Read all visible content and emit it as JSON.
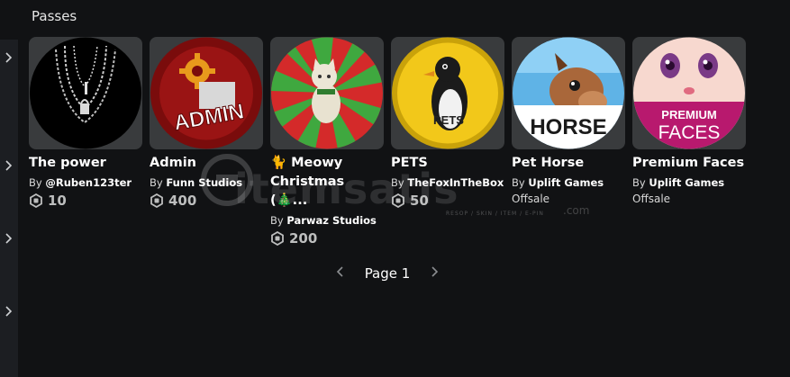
{
  "section": {
    "title": "Passes"
  },
  "passes": [
    {
      "name": "The power",
      "by_prefix": "By ",
      "creator": "@Ruben123ter",
      "price": "10",
      "icon": "necklace-chain-icon"
    },
    {
      "name": "Admin",
      "by_prefix": "By ",
      "creator": "Funn Studios",
      "price": "400",
      "icon": "admin-gear-icon"
    },
    {
      "name": "🐈 Meowy Christmas (🎄...",
      "by_prefix": "By ",
      "creator": "Parwaz Studios",
      "price": "200",
      "icon": "christmas-cat-icon"
    },
    {
      "name": "PETS",
      "by_prefix": "By ",
      "creator": "TheFoxInTheBox",
      "price": "50",
      "icon": "penguin-icon"
    },
    {
      "name": "Pet Horse",
      "by_prefix": "By ",
      "creator": "Uplift Games",
      "status": "Offsale",
      "icon": "horse-icon"
    },
    {
      "name": "Premium Faces",
      "by_prefix": "By ",
      "creator": "Uplift Games",
      "status": "Offsale",
      "icon": "anime-face-icon"
    }
  ],
  "pass_images": {
    "admin_text": "ADMIN",
    "pets_text": "PETS",
    "horse_text": "HORSE",
    "premium_text": "PREMIUM",
    "faces_text": "FACES"
  },
  "pagination": {
    "label": "Page 1"
  },
  "watermark": {
    "brand": "itemsatis",
    "domain": ".com",
    "tagline": "RESOP / SKIN / ITEM / E-PIN"
  },
  "colors": {
    "background": "#111214",
    "card": "#393b3d",
    "rail": "#1c1e22",
    "price": "#bdbebe"
  }
}
